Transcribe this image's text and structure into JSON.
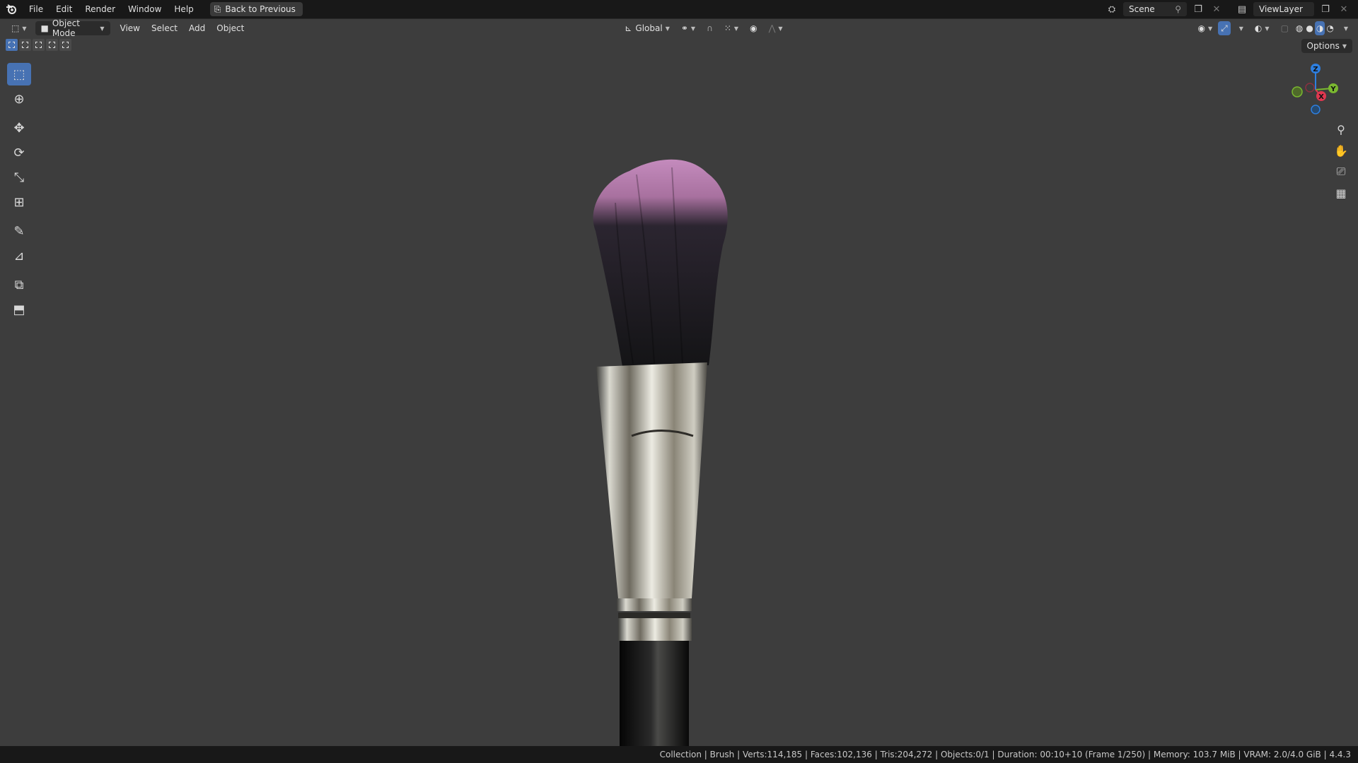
{
  "menu": {
    "items": [
      "File",
      "Edit",
      "Render",
      "Window",
      "Help"
    ],
    "back_label": "Back to Previous"
  },
  "scene": {
    "label": "Scene"
  },
  "view_layer": {
    "label": "ViewLayer"
  },
  "viewport_header": {
    "mode": "Object Mode",
    "menus": [
      "View",
      "Select",
      "Add",
      "Object"
    ],
    "transform_orientation": "Global",
    "options_label": "Options"
  },
  "gizmo": {
    "x": "X",
    "y": "Y",
    "z": "Z"
  },
  "status": {
    "text": "Collection | Brush | Verts:114,185 | Faces:102,136 | Tris:204,272 | Objects:0/1 | Duration: 00:10+10 (Frame 1/250) | Memory: 103.7 MiB | VRAM: 2.0/4.0 GiB | 4.4.3"
  },
  "colors": {
    "active_blue": "#4772b3",
    "viewport_bg": "#3d3d3d",
    "axis_x": "#e0374f",
    "axis_y": "#7ab830",
    "axis_z": "#2d7fe0",
    "bristle_tip": "#b77fb2"
  },
  "icons": {
    "toolbar": [
      "select-box-icon",
      "cursor-icon",
      "move-icon",
      "rotate-icon",
      "scale-icon",
      "transform-icon",
      "annotate-icon",
      "measure-icon",
      "add-cube-icon",
      "extrude-icon"
    ],
    "nav": [
      "zoom-icon",
      "pan-icon",
      "camera-icon",
      "grid-icon"
    ]
  }
}
